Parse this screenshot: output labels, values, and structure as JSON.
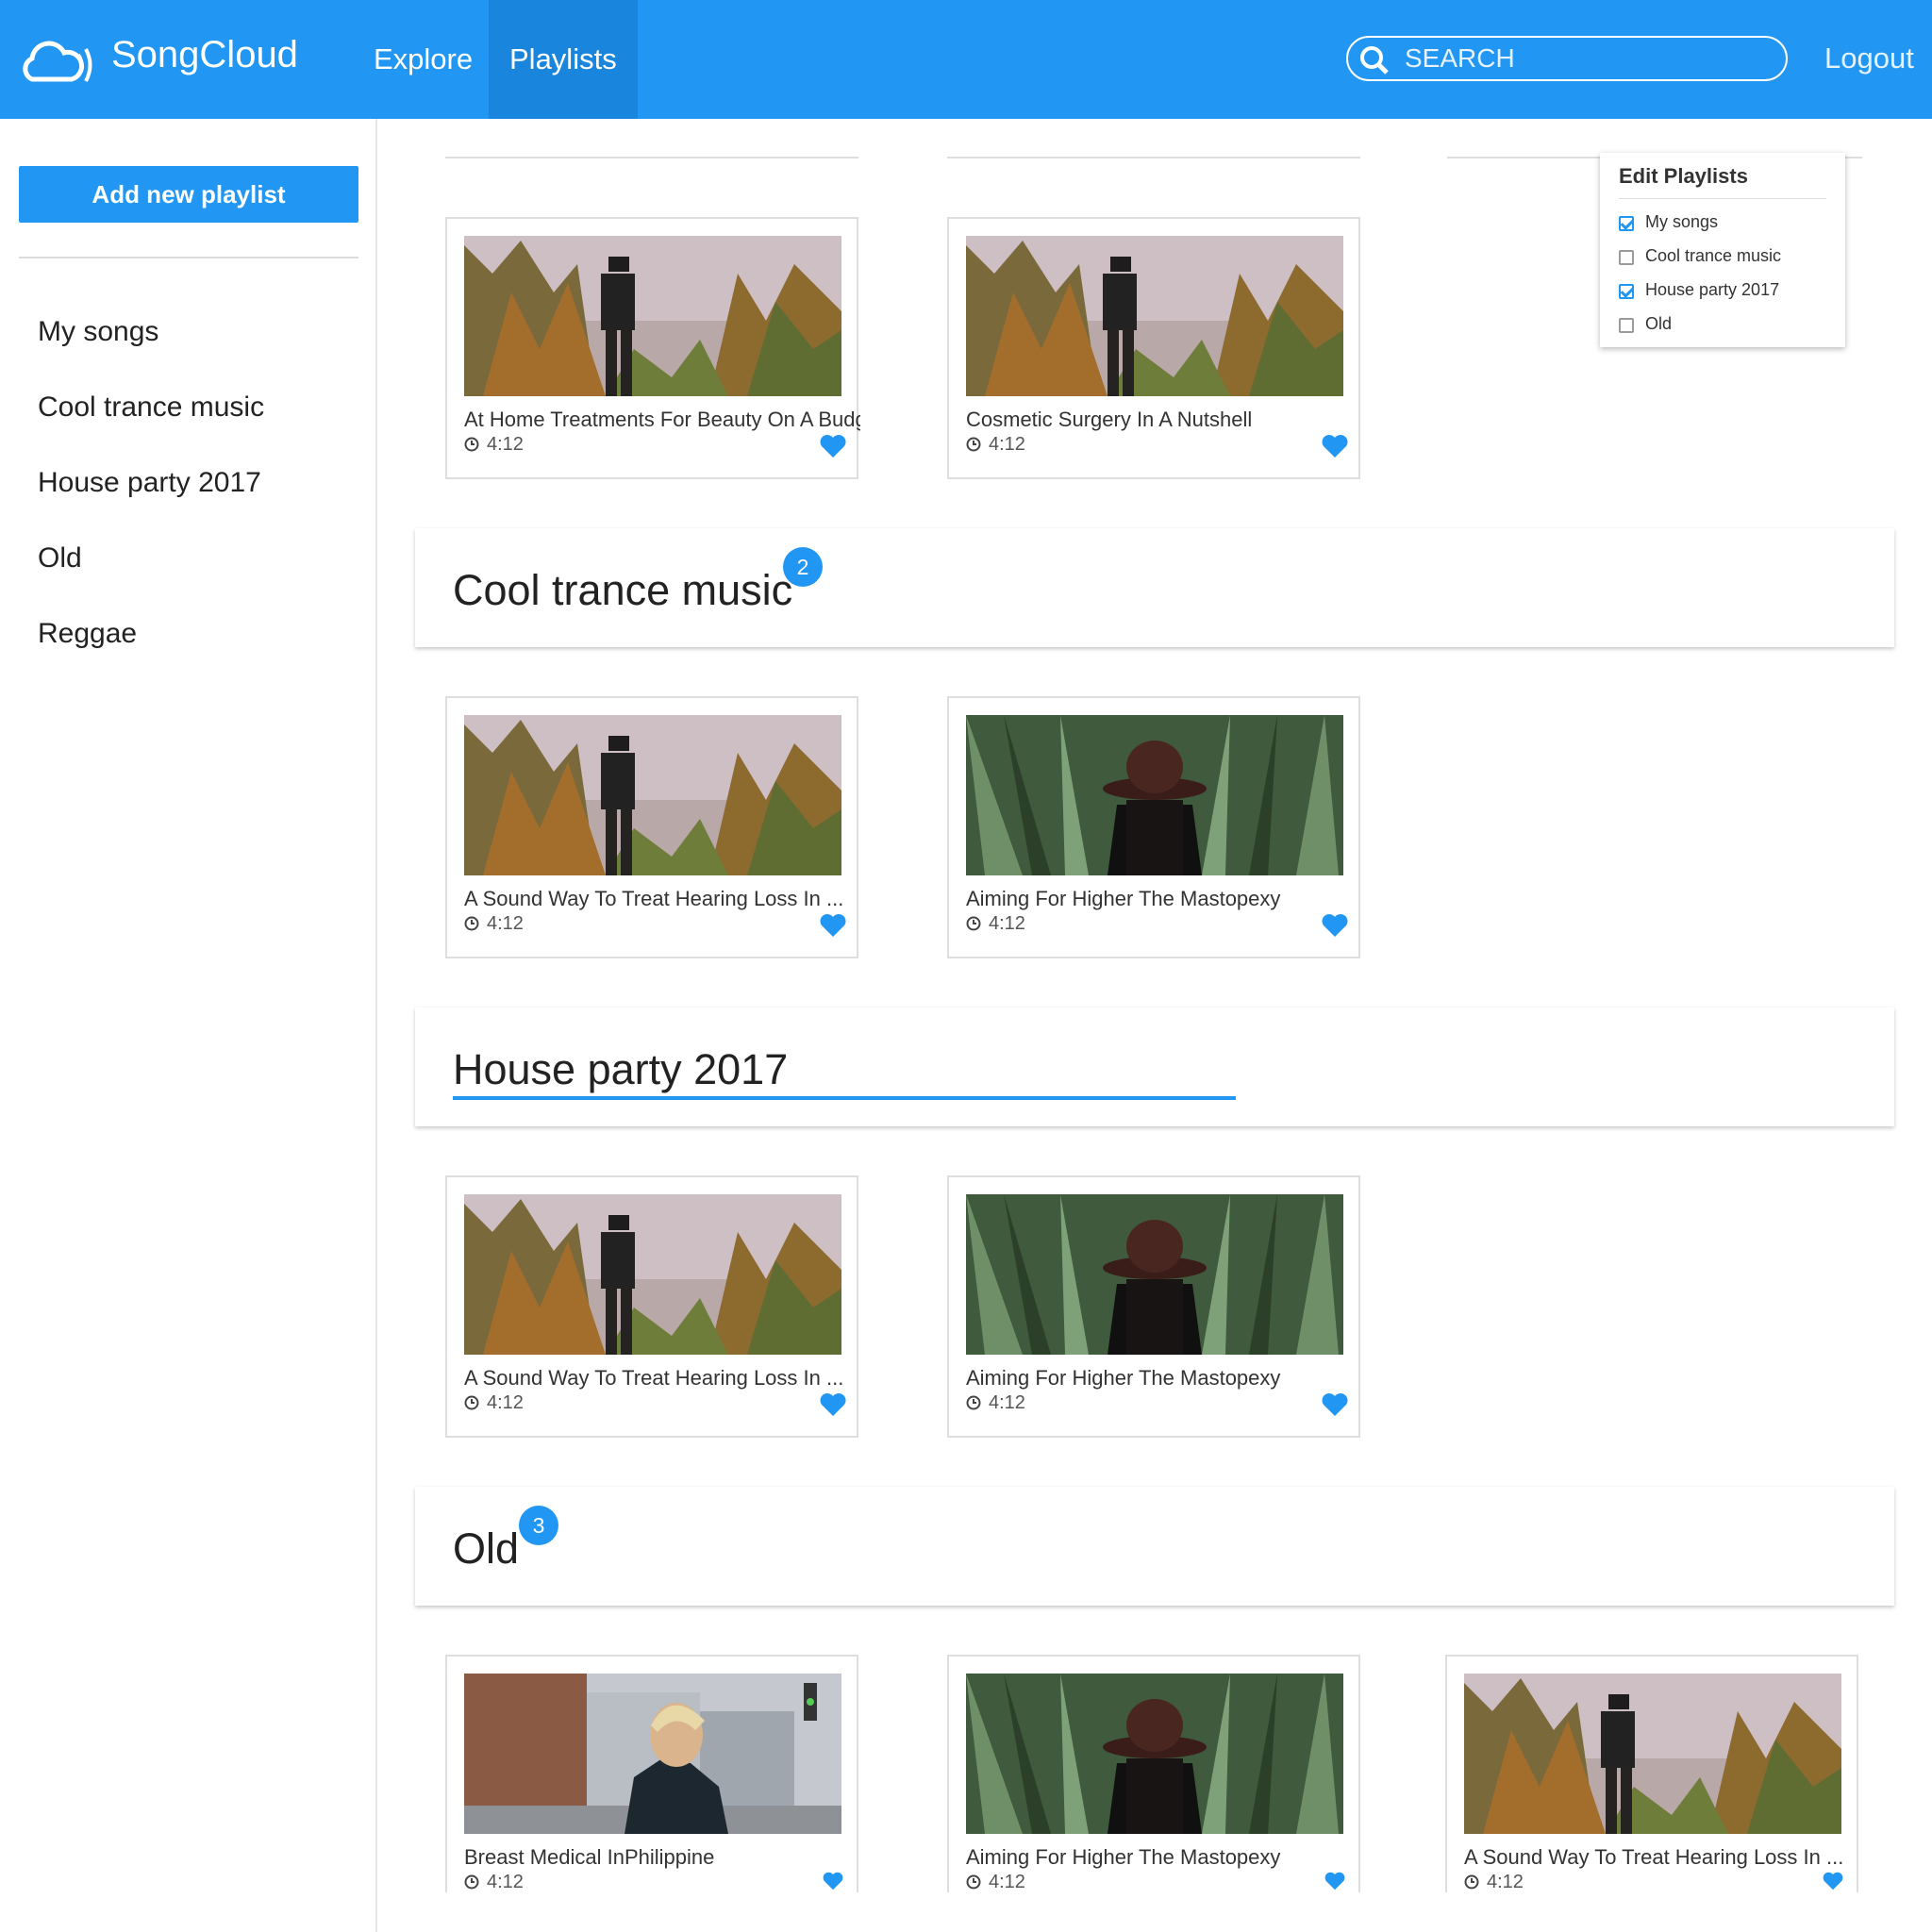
{
  "app": {
    "brand": "SongCloud"
  },
  "nav": {
    "explore": "Explore",
    "playlists": "Playlists",
    "logout": "Logout"
  },
  "search": {
    "placeholder": "SEARCH"
  },
  "sidebar": {
    "add_button": "Add new playlist",
    "items": [
      "My songs",
      "Cool trance music",
      "House party 2017",
      "Old",
      "Reggae"
    ]
  },
  "edit_dropdown": {
    "title": "Edit Playlists",
    "options": [
      {
        "label": "My songs",
        "checked": true
      },
      {
        "label": "Cool trance music",
        "checked": false
      },
      {
        "label": "House party 2017",
        "checked": true
      },
      {
        "label": "Old",
        "checked": false
      }
    ]
  },
  "sections": {
    "first_songs": [
      {
        "title": "At Home Treatments For Beauty On A Budget",
        "duration": "4:12"
      },
      {
        "title": "Cosmetic Surgery In A Nutshell",
        "duration": "4:12"
      }
    ],
    "cool_trance": {
      "name": "Cool trance music",
      "count": "2",
      "songs": [
        {
          "title": "A Sound Way To Treat Hearing Loss In ...",
          "duration": "4:12"
        },
        {
          "title": "Aiming For Higher The Mastopexy",
          "duration": "4:12"
        }
      ]
    },
    "house_party": {
      "name": "House party 2017",
      "songs": [
        {
          "title": "A Sound Way To Treat Hearing Loss In ...",
          "duration": "4:12"
        },
        {
          "title": "Aiming For Higher The Mastopexy",
          "duration": "4:12"
        }
      ]
    },
    "old": {
      "name": "Old",
      "count": "3",
      "songs": [
        {
          "title": "Breast Medical InPhilippine",
          "duration": "4:12"
        },
        {
          "title": "Aiming For Higher The Mastopexy",
          "duration": "4:12"
        },
        {
          "title": "A Sound Way To Treat Hearing Loss In ...",
          "duration": "4:12"
        }
      ]
    }
  },
  "colors": {
    "accent": "#2196f3",
    "header_bg": "#2196f3",
    "active_tab": "#1a85dd"
  },
  "icons": {
    "logo": "cloud-sound-icon",
    "search": "search-icon",
    "clock": "clock-icon",
    "heart": "heart-icon",
    "checkbox": "checkbox-icon"
  }
}
